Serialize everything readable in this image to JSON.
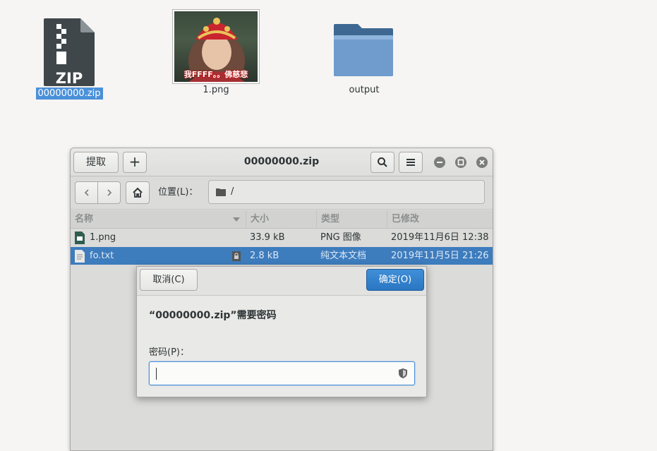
{
  "desktop": {
    "icons": [
      {
        "label": "00000000.zip",
        "type_text": "ZIP",
        "selected": true
      },
      {
        "label": "1.png",
        "thumb_caption": "我FFFF。。佛慈悲"
      },
      {
        "label": "output"
      }
    ]
  },
  "window": {
    "title": "00000000.zip",
    "extract_label": "提取",
    "add_label": "+",
    "location_label": "位置(L)：",
    "path": "/",
    "columns": [
      "名称",
      "大小",
      "类型",
      "已修改"
    ],
    "rows": [
      {
        "name": "1.png",
        "size": "33.9 kB",
        "type": "PNG 图像",
        "modified": "2019年11月6日 12:38",
        "selected": false,
        "encrypted": false
      },
      {
        "name": "fo.txt",
        "size": "2.8 kB",
        "type": "纯文本文档",
        "modified": "2019年11月5日 21:26",
        "selected": true,
        "encrypted": true
      }
    ]
  },
  "dialog": {
    "cancel_label": "取消(C)",
    "ok_label": "确定(O)",
    "message": "“00000000.zip”需要密码",
    "password_label": "密码(P)：",
    "password_value": ""
  },
  "colors": {
    "accent": "#4a90d9",
    "selected_row": "#3d7cbd",
    "folder": "#5a86b4"
  }
}
